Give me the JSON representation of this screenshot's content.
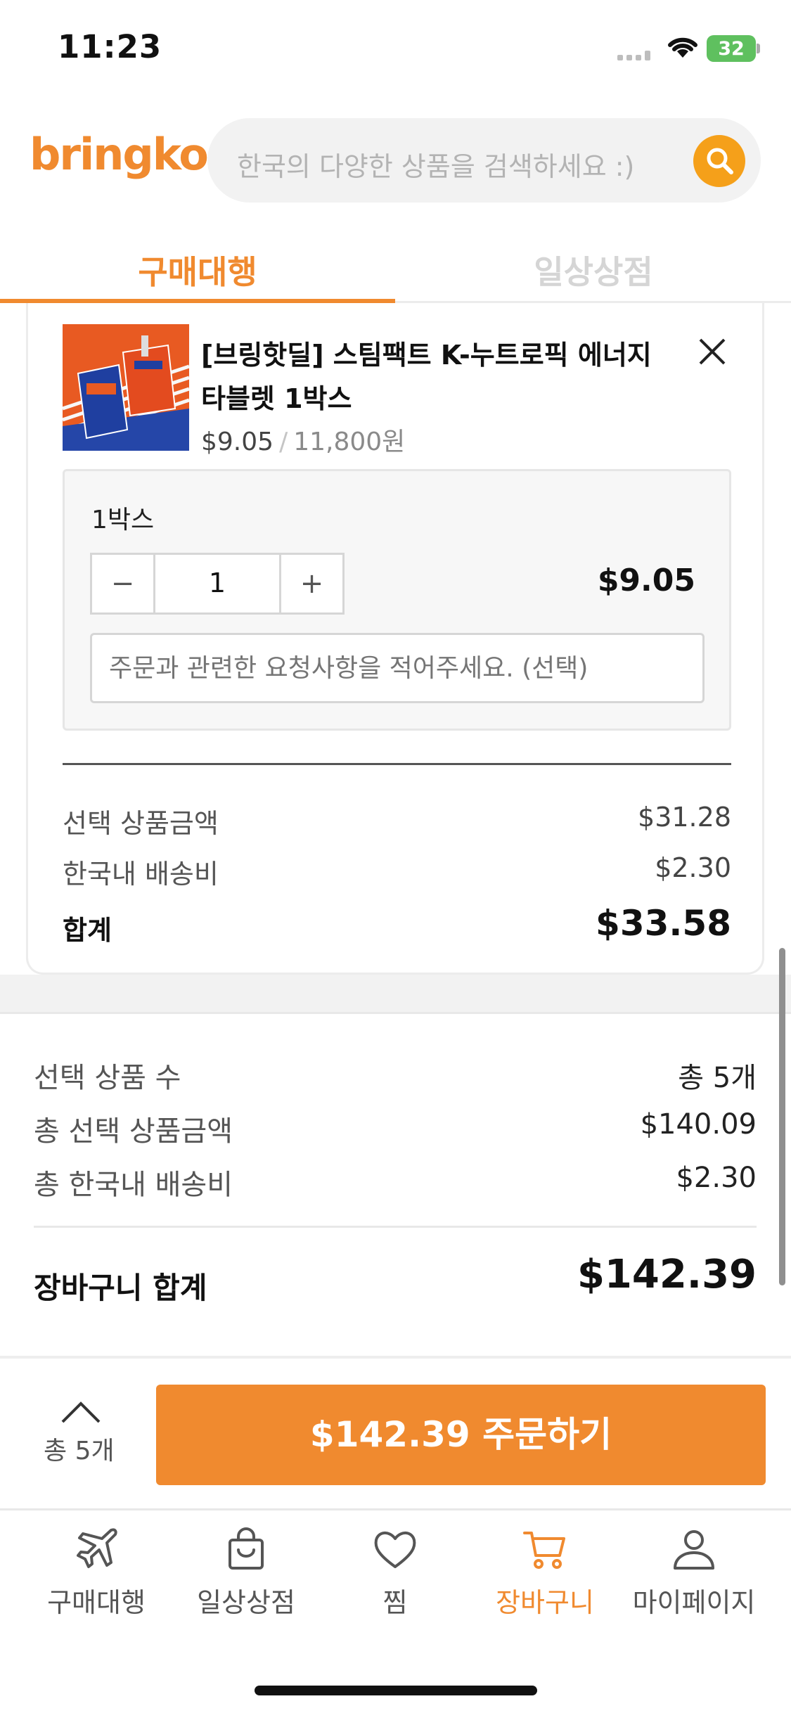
{
  "status_bar": {
    "time": "11:23",
    "battery": "32"
  },
  "header": {
    "logo": "bringko",
    "search_placeholder": "한국의 다양한 상품을 검색하세요 :)"
  },
  "tabs": [
    {
      "label": "구매대행",
      "active": true
    },
    {
      "label": "일상상점",
      "active": false
    }
  ],
  "cart_item": {
    "name": "[브링핫딜] 스팀팩트 K-누트로픽 에너지 타블렛 1박스",
    "price_usd": "$9.05",
    "price_separator": "/",
    "price_krw": "11,800원",
    "option": {
      "name": "1박스",
      "quantity": "1",
      "minus_label": "−",
      "plus_label": "+",
      "total": "$9.05",
      "request_placeholder": "주문과 관련한 요청사항을 적어주세요. (선택)"
    },
    "summary": [
      {
        "label": "선택 상품금액",
        "value": "$31.28"
      },
      {
        "label": "한국내 배송비",
        "value": "$2.30"
      },
      {
        "label": "합계",
        "value": "$33.58"
      }
    ]
  },
  "cart_summary": {
    "rows": [
      {
        "label": "선택 상품 수",
        "value": "총 5개"
      },
      {
        "label": "총 선택 상품금액",
        "value": "$140.09"
      },
      {
        "label": "총 한국내 배송비",
        "value": "$2.30"
      }
    ],
    "total_label": "장바구니 합계",
    "total_value": "$142.39"
  },
  "checkout": {
    "count": "총 5개",
    "button": "$142.39 주문하기"
  },
  "bottom_nav": [
    {
      "label": "구매대행",
      "icon": "airplane-icon"
    },
    {
      "label": "일상상점",
      "icon": "shopping-bag-icon"
    },
    {
      "label": "찜",
      "icon": "heart-icon"
    },
    {
      "label": "장바구니",
      "icon": "cart-icon",
      "active": true
    },
    {
      "label": "마이페이지",
      "icon": "person-icon"
    }
  ],
  "colors": {
    "accent": "#f08a2f",
    "search_button": "#f5a01a",
    "battery": "#5fc05f"
  }
}
